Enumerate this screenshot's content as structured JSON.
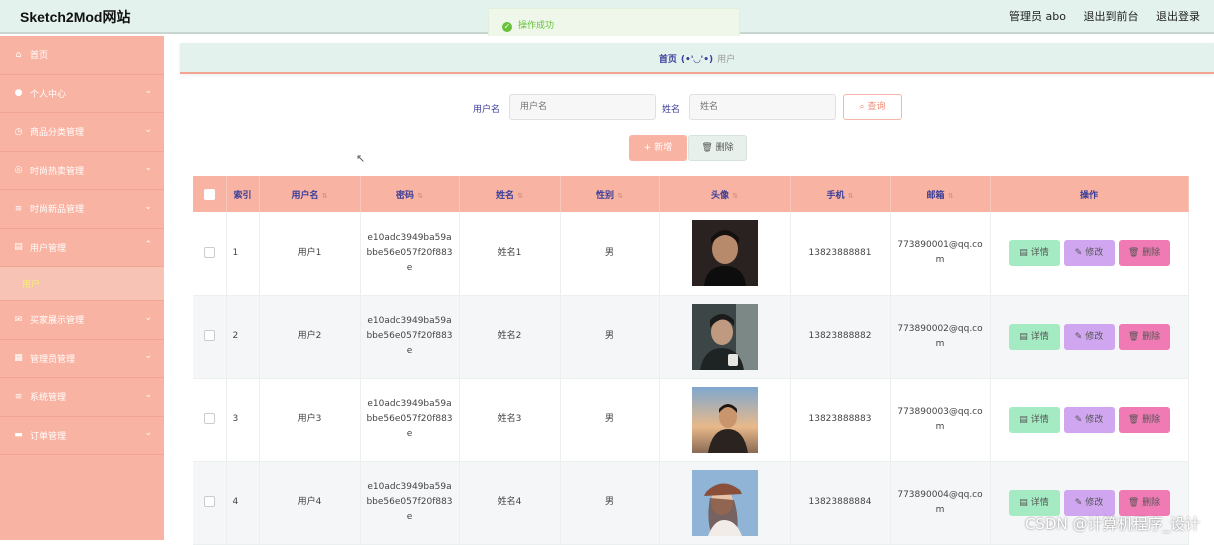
{
  "header": {
    "logo": "Sketch2Mod网站",
    "admin": "管理员 abo",
    "to_front": "退出到前台",
    "logout": "退出登录"
  },
  "toast": {
    "icon": "check-circle-icon",
    "text": "操作成功"
  },
  "sidebar": {
    "items": [
      {
        "label": "首页",
        "icon": "home-icon"
      },
      {
        "label": "个人中心",
        "icon": "user-icon"
      },
      {
        "label": "商品分类管理",
        "icon": "clock-icon"
      },
      {
        "label": "时尚热卖管理",
        "icon": "globe-icon"
      },
      {
        "label": "时尚新品管理",
        "icon": "list-icon"
      },
      {
        "label": "用户管理",
        "icon": "clipboard-icon"
      },
      {
        "label": "买家展示管理",
        "icon": "mail-icon"
      },
      {
        "label": "管理员管理",
        "icon": "grid-icon"
      },
      {
        "label": "系统管理",
        "icon": "menu-icon"
      },
      {
        "label": "订单管理",
        "icon": "ticket-icon"
      }
    ],
    "active_sub": "用户"
  },
  "breadcrumb": {
    "home": "首页",
    "sep": "(•'◡'•)",
    "current": "用户"
  },
  "search": {
    "username_label": "用户名",
    "username_placeholder": "用户名",
    "name_label": "姓名",
    "name_placeholder": "姓名",
    "query": "查询"
  },
  "toolbar": {
    "add": "新增",
    "delete": "删除"
  },
  "table": {
    "headers": [
      "索引",
      "用户名",
      "密码",
      "姓名",
      "性别",
      "头像",
      "手机",
      "邮箱",
      "操作"
    ],
    "rows": [
      {
        "idx": "1",
        "username": "用户1",
        "pw1": "e10adc3949ba59a",
        "pw2": "bbe56e057f20f883",
        "pw3": "e",
        "name": "姓名1",
        "gender": "男",
        "phone": "13823888881",
        "email1": "773890001@qq.co",
        "email2": "m"
      },
      {
        "idx": "2",
        "username": "用户2",
        "pw1": "e10adc3949ba59a",
        "pw2": "bbe56e057f20f883",
        "pw3": "e",
        "name": "姓名2",
        "gender": "男",
        "phone": "13823888882",
        "email1": "773890002@qq.co",
        "email2": "m"
      },
      {
        "idx": "3",
        "username": "用户3",
        "pw1": "e10adc3949ba59a",
        "pw2": "bbe56e057f20f883",
        "pw3": "e",
        "name": "姓名3",
        "gender": "男",
        "phone": "13823888883",
        "email1": "773890003@qq.co",
        "email2": "m"
      },
      {
        "idx": "4",
        "username": "用户4",
        "pw1": "e10adc3949ba59a",
        "pw2": "bbe56e057f20f883",
        "pw3": "e",
        "name": "姓名4",
        "gender": "男",
        "phone": "13823888884",
        "email1": "773890004@qq.co",
        "email2": "m"
      }
    ],
    "actions": {
      "detail": "详情",
      "edit": "修改",
      "del": "删除"
    }
  },
  "watermark": "CSDN @计算机程序_设计",
  "colors": {
    "sidebar": "#f9b3a2",
    "header": "#e3f2ec",
    "detail": "#a4ebc3",
    "edit": "#cfa6ef",
    "delete": "#f07bb4"
  }
}
